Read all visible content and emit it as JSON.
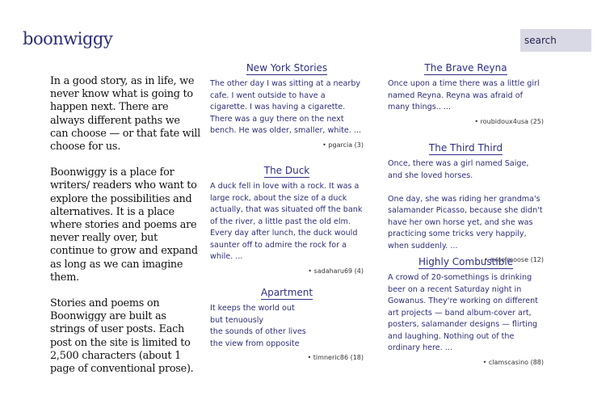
{
  "header": {
    "logo": "boonwiggy",
    "search_placeholder": "search"
  },
  "intro": [
    "In a good story, as in life, we never know what is going to happen next. There are always different paths we can choose — or that fate will choose for us.",
    "Boonwiggy is a place for writers/ readers who want to explore the possibilities and alternatives.  It is a place where stories and poems are never really over, but continue to grow and expand as long as we can imagine them.",
    "Stories and poems on Boonwiggy are built as strings of user posts.  Each post on the site is limited to 2,500 characters (about 1 page of conventional prose)."
  ],
  "stories": [
    {
      "title": "New York Stories",
      "body": "The other day I was sitting at a nearby cafe. I went outside to have a cigarette. I was having a cigarette. There was a guy there on the next bench. He was older, smaller, white. ...",
      "author": "• pgarcia (3)"
    },
    {
      "title": "The Duck",
      "body": "A duck fell in love with a rock. It was a large rock, about the size of a duck actually, that was situated off the bank of the river, a little past the old elm. Every day after lunch, the duck would saunter off to admire the rock for a while. ...",
      "author": "• sadaharu69 (4)"
    },
    {
      "title": "Apartment",
      "body": "It keeps the world out\nbut tenuously\nthe sounds of other lives\nthe view from opposite",
      "author": "• timneric86 (18)"
    },
    {
      "title": "The Brave Reyna",
      "body": "Once upon a time there was a little girl named Reyna. Reyna was afraid of many things.. ...",
      "author": "• roubidoux4usa (25)"
    },
    {
      "title": "The Third Third",
      "body": "Once, there was a girl named Saige, and she loved horses.\n\nOne day, she was riding her grandma's salamander Picasso, because she didn't have her own horse yet, and she was practicing some tricks very happily, when suddenly. ...",
      "author": "• excelmoose (12)"
    },
    {
      "title": "Highly Combustible",
      "body": "A crowd of 20-somethings is drinking beer on a recent Saturday night in Gowanus. They're working on different art projects — band album-cover art, posters, salamander designs — flirting and laughing. Nothing out of the ordinary here. ...",
      "author": "• clamscasino (88)"
    }
  ]
}
